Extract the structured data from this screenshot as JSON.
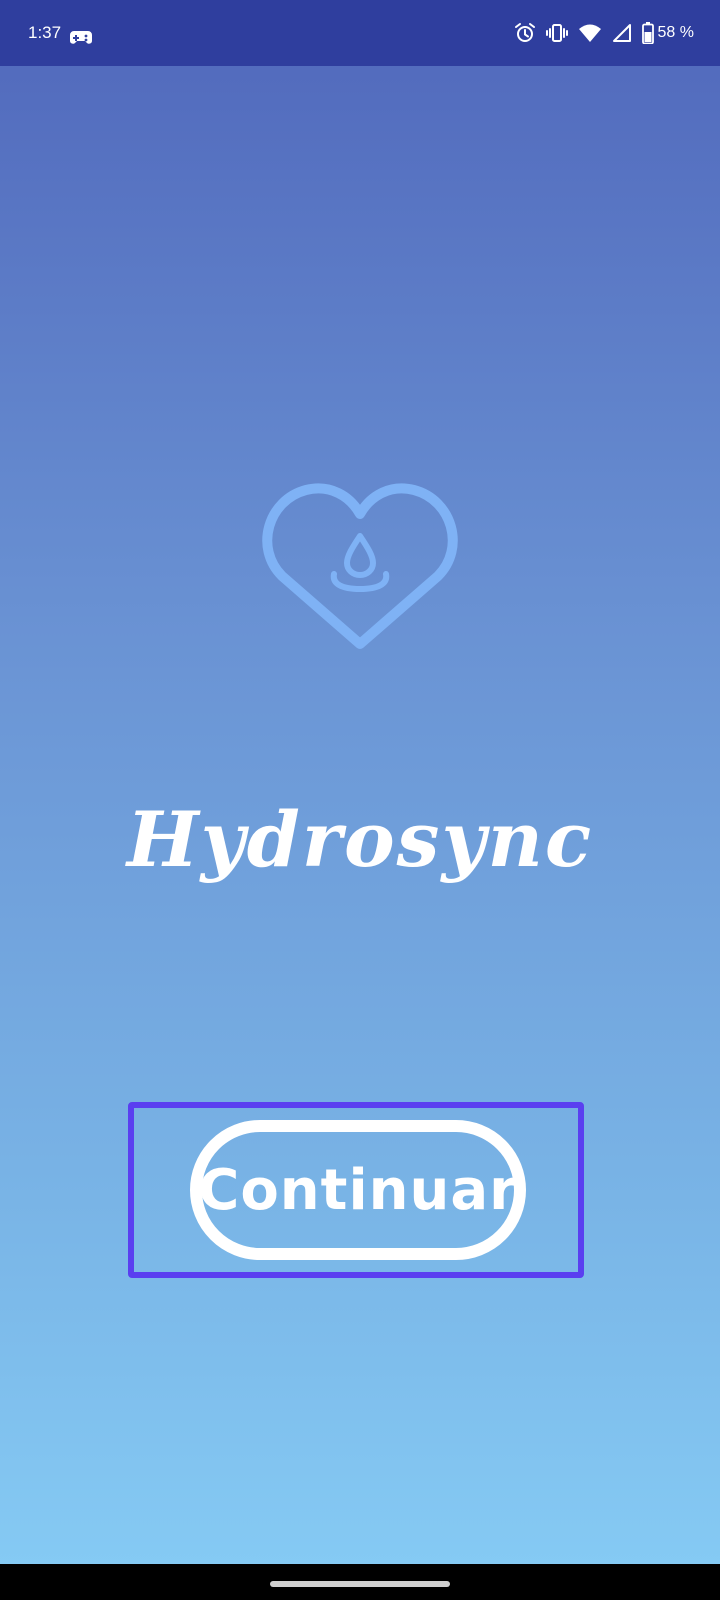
{
  "status_bar": {
    "time": "1:37",
    "battery_percent": "58 %",
    "icons": [
      "game-controller-icon",
      "alarm-icon",
      "vibrate-icon",
      "wifi-icon",
      "cell-signal-icon",
      "battery-icon"
    ]
  },
  "app": {
    "logo_icon": "heart-water-drop-icon",
    "title": "Hydrosync",
    "continue_label": "Continuar"
  },
  "colors": {
    "status_bar_bg": "#2f3e9e",
    "gradient_top": "#5067bb",
    "gradient_bottom": "#86ccf5",
    "logo_stroke": "#7fb2f5",
    "highlight": "#5a3ff0"
  }
}
